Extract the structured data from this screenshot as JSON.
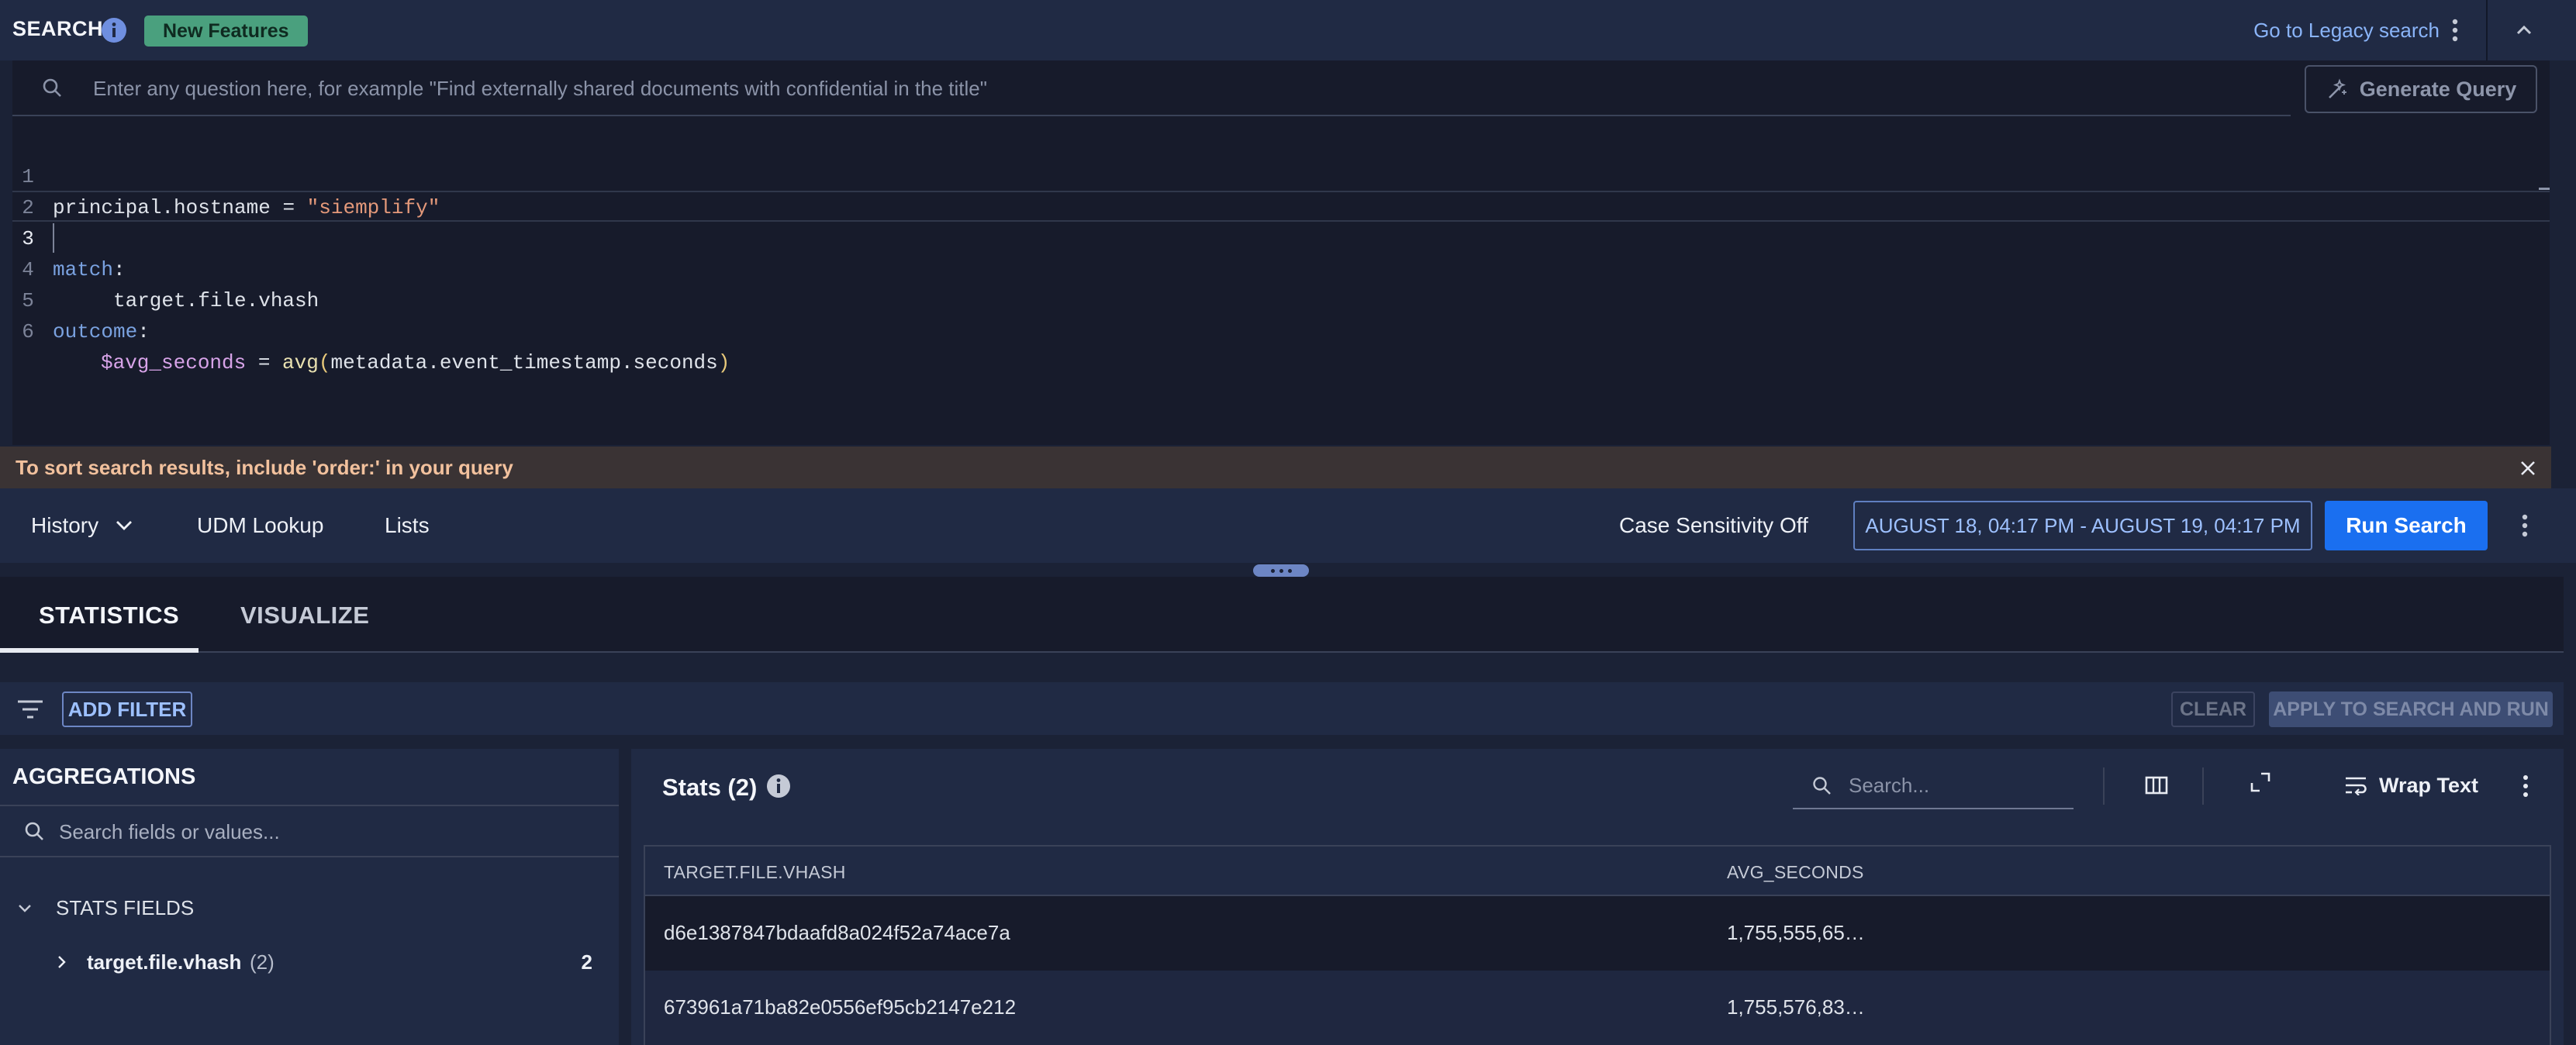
{
  "header": {
    "title": "SEARCH",
    "new_features_label": "New Features",
    "legacy_link": "Go to Legacy search"
  },
  "query": {
    "placeholder": "Enter any question here, for example \"Find externally shared documents with confidential in the title\"",
    "generate_label": "Generate Query"
  },
  "editor": {
    "line_numbers": [
      "1",
      "2",
      "3",
      "4",
      "5",
      "6"
    ],
    "lines": {
      "l1_field": "principal.hostname",
      "l1_op": " = ",
      "l1_string": "\"siemplify\"",
      "l3_keyword": "match",
      "l3_colon": ":",
      "l4_field": "target.file.vhash",
      "l5_keyword": "outcome",
      "l5_colon": ":",
      "l6_var": "$avg_seconds",
      "l6_op": " = ",
      "l6_fn": "avg",
      "l6_open": "(",
      "l6_arg": "metadata.event_timestamp.seconds",
      "l6_close": ")"
    }
  },
  "tip": {
    "text": "To sort search results, include 'order:' in your query"
  },
  "toolbar": {
    "history_label": "History",
    "udm_lookup_label": "UDM Lookup",
    "lists_label": "Lists",
    "case_sensitivity_label": "Case Sensitivity Off",
    "date_range": "AUGUST 18, 04:17 PM - AUGUST 19, 04:17 PM",
    "run_search_label": "Run Search"
  },
  "tabs": [
    {
      "label": "STATISTICS",
      "active": true
    },
    {
      "label": "VISUALIZE",
      "active": false
    }
  ],
  "filters": {
    "add_filter_label": "ADD FILTER",
    "clear_label": "CLEAR",
    "apply_label": "APPLY TO SEARCH AND RUN"
  },
  "aggregations": {
    "title": "AGGREGATIONS",
    "search_placeholder": "Search fields or values...",
    "section_label": "STATS FIELDS",
    "fields": [
      {
        "name": "target.file.vhash",
        "badge": "(2)",
        "count": "2"
      }
    ]
  },
  "stats": {
    "title": "Stats (2)",
    "search_placeholder": "Search...",
    "wrap_text_label": "Wrap Text",
    "columns": [
      "TARGET.FILE.VHASH",
      "AVG_SECONDS"
    ],
    "rows": [
      [
        "d6e1387847bdaafd8a024f52a74ace7a",
        "1,755,555,65…"
      ],
      [
        "673961a71ba82e0556ef95cb2147e212",
        "1,755,576,83…"
      ]
    ]
  },
  "icons": {
    "info": "info-icon",
    "kebab": "more-vert-icon",
    "collapse": "chevron-up-icon",
    "search": "search-icon",
    "magic": "magic-wand-icon",
    "close": "close-icon",
    "filter": "filter-list-icon",
    "columns": "view-columns-icon",
    "expand": "expand-icon",
    "wrap": "wrap-text-icon"
  },
  "colors": {
    "accent": "#1a6ff0",
    "link": "#8ab4f8",
    "badge_green": "#4aa07e",
    "tip_text": "#f2c19d",
    "panel_bg": "#202a44",
    "editor_bg": "#171b2b"
  }
}
